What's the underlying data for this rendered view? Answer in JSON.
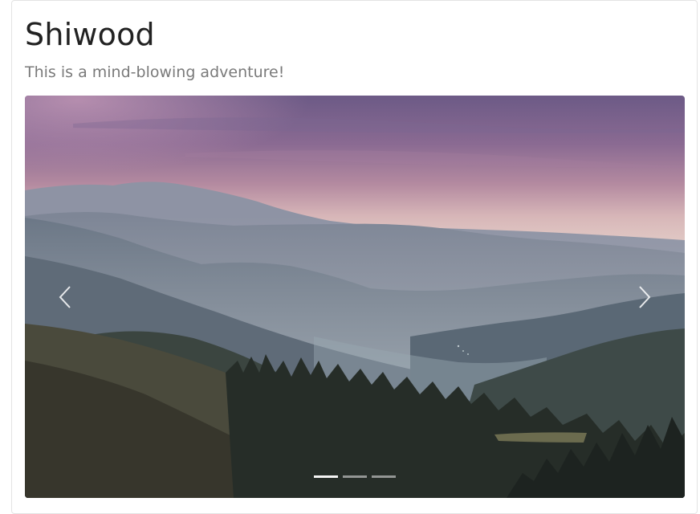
{
  "card": {
    "title": "Shiwood",
    "subtitle": "This is a mind-blowing adventure!"
  },
  "carousel": {
    "image_description": "mountain-valley-sunset-photo",
    "active_slide": 1,
    "slide_count": 3,
    "prev_icon": "chevron-left-icon",
    "next_icon": "chevron-right-icon"
  },
  "colors": {
    "title": "#222222",
    "subtitle": "#7a7a7a",
    "border": "#e3e3e3"
  }
}
